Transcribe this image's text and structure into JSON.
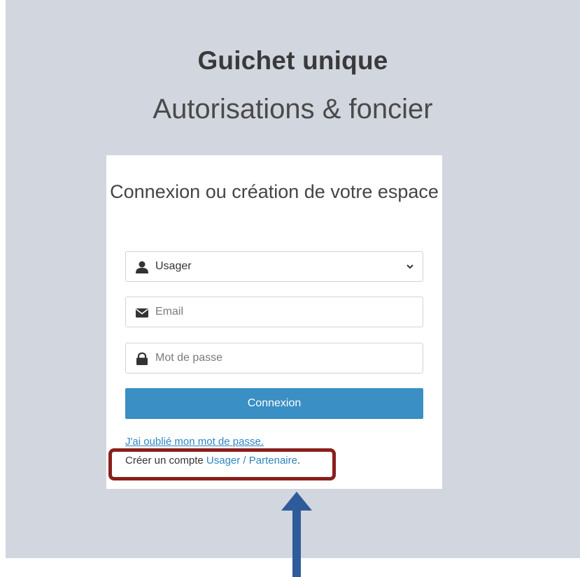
{
  "header": {
    "title": "Guichet unique",
    "subtitle": "Autorisations & foncier"
  },
  "login_card": {
    "title": "Connexion ou création de votre espace",
    "user_type_select": {
      "selected": "Usager",
      "icon": "user-icon"
    },
    "email_field": {
      "placeholder": "Email",
      "icon": "envelope-icon"
    },
    "password_field": {
      "placeholder": "Mot de passe",
      "icon": "lock-icon"
    },
    "submit_label": "Connexion",
    "forgot_password": "J'ai oublié mon mot de passe.",
    "create_account_prefix": "Créer un compte ",
    "create_account_link": "Usager / Partenaire",
    "create_account_suffix": "."
  },
  "colors": {
    "background": "#d1d6df",
    "button": "#3a8fc4",
    "link": "#2f85c2",
    "highlight": "#8a1f1c",
    "arrow": "#2e5c9a"
  }
}
